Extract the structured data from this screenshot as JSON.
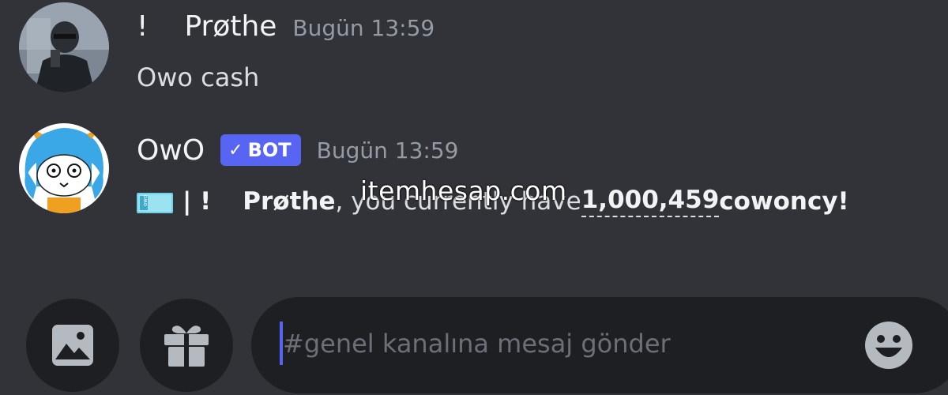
{
  "messages": [
    {
      "prefix": "!",
      "username": "Prøthe",
      "timestamp": "Bugün 13:59",
      "text": "Owo cash"
    },
    {
      "username": "OwO",
      "badge": "BOT",
      "badge_check": "✓",
      "timestamp": "Bugün 13:59",
      "reply": {
        "icon": "cash-icon",
        "marker": "| !",
        "mention": "Prøthe",
        "middle": ", you currently have ",
        "amount": "1,000,459",
        "suffix": " cowoncy!"
      }
    }
  ],
  "watermark": "itemhesap.com",
  "composer": {
    "placeholder": "#genel kanalına mesaj gönder",
    "image_button": "image-icon",
    "gift_button": "gift-icon",
    "emoji_button": "emoji-icon"
  },
  "colors": {
    "background": "#313338",
    "input_background": "#1e1f22",
    "accent": "#5865f2",
    "muted": "#949ba4"
  }
}
